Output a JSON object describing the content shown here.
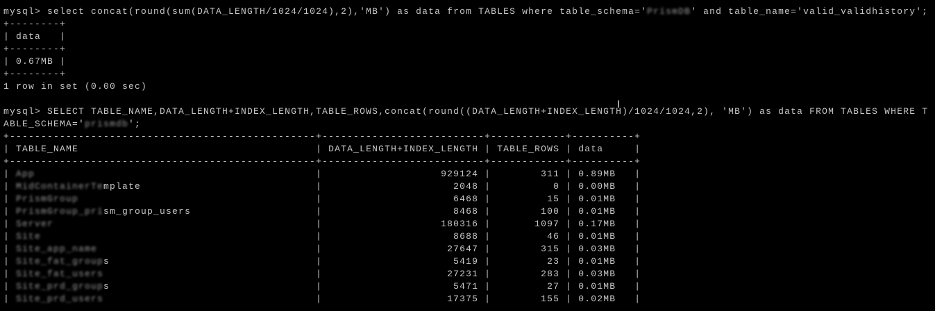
{
  "query1": {
    "prompt": "mysql> ",
    "before_schema": "select concat(round(sum(DATA_LENGTH/1024/1024),2),'MB') as data from TABLES where table_schema='",
    "schema": "PrismDB",
    "after_schema": "' and table_name='valid_validhistory';",
    "header": "data",
    "value": "0.67MB",
    "footer": "1 row in set (0.00 sec)"
  },
  "query2": {
    "prompt": "mysql> ",
    "line1": "SELECT TABLE_NAME,DATA_LENGTH+INDEX_LENGTH,TABLE_ROWS,concat(round((DATA_LENGTH+INDEX_LENGTH)/1024/1024,2), 'MB') as data FROM TABLES WHERE T",
    "line2_before": "ABLE_SCHEMA='",
    "schema": "prismdb",
    "line2_after": "';",
    "columns": [
      "TABLE_NAME",
      "DATA_LENGTH+INDEX_LENGTH",
      "TABLE_ROWS",
      "data"
    ],
    "rows": [
      {
        "hidden": "App",
        "visible": "",
        "size": "929124",
        "rows": "311",
        "data": "0.89MB"
      },
      {
        "hidden": "MidContainerTe",
        "visible": "mplate",
        "size": "2048",
        "rows": "0",
        "data": "0.00MB"
      },
      {
        "hidden": "PrismGroup",
        "visible": "",
        "size": "6468",
        "rows": "15",
        "data": "0.01MB"
      },
      {
        "hidden": "PrismGroup_pri",
        "visible": "sm_group_users",
        "size": "8468",
        "rows": "100",
        "data": "0.01MB"
      },
      {
        "hidden": "Server",
        "visible": "",
        "size": "180316",
        "rows": "1097",
        "data": "0.17MB"
      },
      {
        "hidden": "Site",
        "visible": "",
        "size": "8688",
        "rows": "46",
        "data": "0.01MB"
      },
      {
        "hidden": "Site_app_name",
        "visible": "",
        "size": "27647",
        "rows": "315",
        "data": "0.03MB"
      },
      {
        "hidden": "Site_fat_group",
        "visible": "s",
        "size": "5419",
        "rows": "23",
        "data": "0.01MB"
      },
      {
        "hidden": "Site_fat_users",
        "visible": "",
        "size": "27231",
        "rows": "283",
        "data": "0.03MB"
      },
      {
        "hidden": "Site_prd_group",
        "visible": "s",
        "size": "5471",
        "rows": "27",
        "data": "0.01MB"
      },
      {
        "hidden": "Site_prd_users",
        "visible": "",
        "size": "17375",
        "rows": "155",
        "data": "0.02MB"
      }
    ]
  }
}
